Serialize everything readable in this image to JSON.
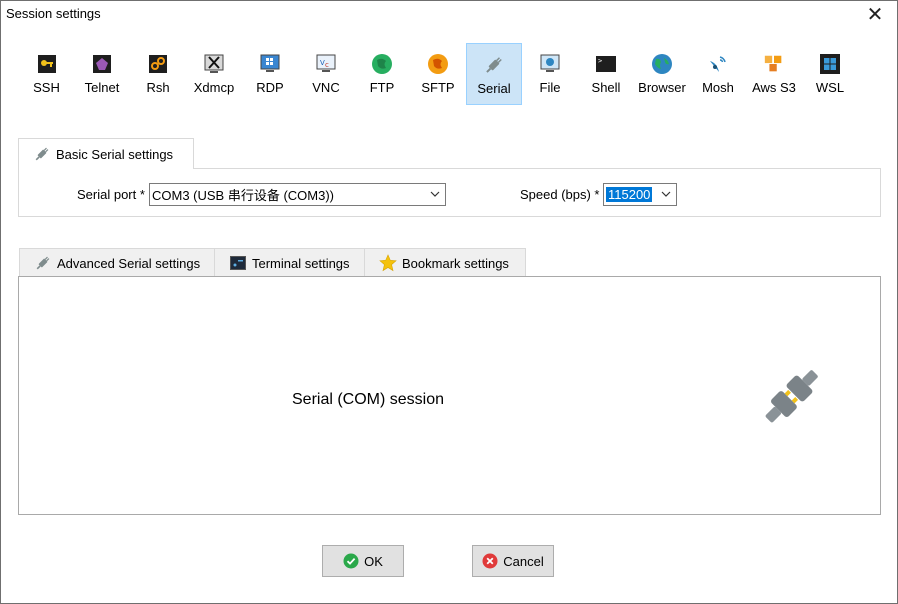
{
  "window": {
    "title": "Session settings",
    "close_glyph": "✕"
  },
  "toolbar": {
    "items": [
      {
        "label": "SSH",
        "icon": "key-icon"
      },
      {
        "label": "Telnet",
        "icon": "telnet-icon"
      },
      {
        "label": "Rsh",
        "icon": "rsh-icon"
      },
      {
        "label": "Xdmcp",
        "icon": "xdmcp-icon"
      },
      {
        "label": "RDP",
        "icon": "rdp-icon"
      },
      {
        "label": "VNC",
        "icon": "vnc-icon"
      },
      {
        "label": "FTP",
        "icon": "ftp-icon"
      },
      {
        "label": "SFTP",
        "icon": "sftp-icon"
      },
      {
        "label": "Serial",
        "icon": "plug-icon",
        "active": true
      },
      {
        "label": "File",
        "icon": "file-icon"
      },
      {
        "label": "Shell",
        "icon": "shell-icon"
      },
      {
        "label": "Browser",
        "icon": "globe-icon"
      },
      {
        "label": "Mosh",
        "icon": "satellite-icon"
      },
      {
        "label": "Aws S3",
        "icon": "aws-s3-icon"
      },
      {
        "label": "WSL",
        "icon": "windows-icon"
      }
    ]
  },
  "basic": {
    "tab_label": "Basic Serial settings",
    "serial_port_label": "Serial port *",
    "serial_port_value": "COM3  (USB 串行设备 (COM3))",
    "speed_label": "Speed (bps) *",
    "speed_value": "115200"
  },
  "tabs": {
    "advanced": "Advanced Serial settings",
    "terminal": "Terminal settings",
    "bookmark": "Bookmark settings"
  },
  "main": {
    "session_text": "Serial (COM) session"
  },
  "buttons": {
    "ok": "OK",
    "cancel": "Cancel"
  },
  "colors": {
    "accent": "#0078d7",
    "active_bg": "#cce4f7",
    "ok_green": "#2aa84a",
    "cancel_red": "#e03a3a"
  }
}
